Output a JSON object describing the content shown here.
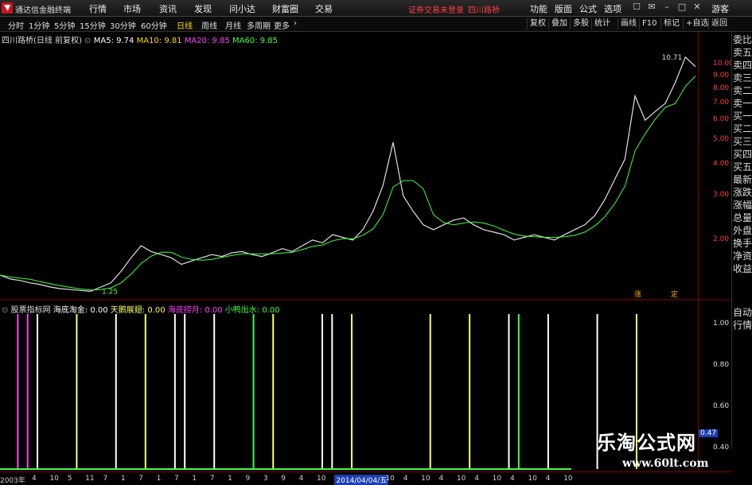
{
  "titlebar": {
    "app_title": "通达信金融终端",
    "menu": [
      "行情",
      "市场",
      "资讯",
      "发现",
      "问小达",
      "财富圈",
      "交易"
    ],
    "warning": "证券交易未登录",
    "stock_name": "四川路桥",
    "right_menu": [
      "功能",
      "版面",
      "公式",
      "选项"
    ],
    "user_label": "游客"
  },
  "toolbar": {
    "periods": [
      "分时",
      "1分钟",
      "5分钟",
      "15分钟",
      "30分钟",
      "60分钟",
      "日线",
      "周线",
      "月线",
      "多周期",
      "更多"
    ],
    "active_period": "日线",
    "right_buttons": [
      "复权",
      "叠加",
      "多股",
      "统计",
      "画线",
      "F10",
      "标记",
      "+自选",
      "返回"
    ]
  },
  "main_chart": {
    "title": "四川路桥(日线 前复权)",
    "ma": [
      {
        "label": "MA5: 9.74",
        "color": "#ffffff"
      },
      {
        "label": "MA10: 9.81",
        "color": "#ffd700"
      },
      {
        "label": "MA20: 9.85",
        "color": "#ff40ff"
      },
      {
        "label": "MA60: 9.85",
        "color": "#40ff40"
      }
    ],
    "high_label": "10.71",
    "low_label": "1.25",
    "event_labels": [
      "涨",
      "定"
    ]
  },
  "right_panel": [
    "委比",
    "卖五",
    "卖四",
    "卖三",
    "卖二",
    "卖一",
    "买一",
    "买二",
    "买三",
    "买四",
    "买五",
    "最新",
    "涨跌",
    "涨幅",
    "总量",
    "外盘",
    "换手",
    "净资",
    "收益",
    "自动",
    "行情"
  ],
  "indicator": {
    "name": "股票指标网",
    "items": [
      {
        "label": "海底淘金: 0.00",
        "color": "#ffffff"
      },
      {
        "label": "天鹅展翅: 0.00",
        "color": "#ffff60"
      },
      {
        "label": "海底捞月: 0.00",
        "color": "#ff40ff"
      },
      {
        "label": "小鸭出水: 0.00",
        "color": "#40ff40"
      }
    ],
    "current_value": "0.47"
  },
  "chart_data": {
    "type": "line",
    "title": "",
    "xlabel": "",
    "ylabel": "",
    "y_scale": "log",
    "ylim": [
      1.2,
      11.5
    ],
    "price_series": {
      "name": "",
      "values": [
        1.45,
        1.4,
        1.38,
        1.35,
        1.33,
        1.3,
        1.28,
        1.27,
        1.26,
        1.25,
        1.3,
        1.35,
        1.5,
        1.7,
        1.9,
        1.8,
        1.75,
        1.7,
        1.6,
        1.65,
        1.7,
        1.75,
        1.72,
        1.78,
        1.8,
        1.75,
        1.72,
        1.78,
        1.85,
        1.8,
        1.9,
        2.0,
        1.95,
        2.1,
        2.05,
        2.0,
        2.2,
        2.6,
        3.3,
        4.9,
        3.0,
        2.6,
        2.3,
        2.2,
        2.3,
        2.4,
        2.45,
        2.3,
        2.2,
        2.15,
        2.1,
        2.0,
        2.05,
        2.1,
        2.05,
        2.0,
        2.1,
        2.2,
        2.3,
        2.5,
        2.9,
        3.5,
        4.2,
        7.5,
        6.0,
        6.5,
        7.0,
        8.5,
        10.71,
        9.8
      ]
    },
    "price_ticks": [
      "10.00",
      "9.00",
      "8.00",
      "7.00",
      "6.00",
      "5.00",
      "4.00",
      "3.00",
      "2.00"
    ],
    "price_tick_values": [
      10,
      9,
      8,
      7,
      6,
      5,
      4,
      3,
      2
    ],
    "indicator_ticks": [
      "1.00",
      "0.80",
      "0.60",
      "0.40"
    ],
    "indicator_tick_values": [
      1.0,
      0.8,
      0.6,
      0.4
    ],
    "indicator_ylim": [
      0.3,
      1.05
    ],
    "signal_count": 70,
    "signals": [
      {
        "index": 1,
        "color": "#ff40ff"
      },
      {
        "index": 2,
        "color": "#ff40ff"
      },
      {
        "index": 3,
        "color": "#ffffff"
      },
      {
        "index": 7,
        "color": "#ffff60"
      },
      {
        "index": 11,
        "color": "#ffffff"
      },
      {
        "index": 14,
        "color": "#ffff60"
      },
      {
        "index": 17,
        "color": "#ffffff"
      },
      {
        "index": 18,
        "color": "#ffffff"
      },
      {
        "index": 21,
        "color": "#ffffff"
      },
      {
        "index": 25,
        "color": "#40ff40"
      },
      {
        "index": 27,
        "color": "#ffff60"
      },
      {
        "index": 32,
        "color": "#ffffff"
      },
      {
        "index": 33,
        "color": "#ffffff"
      },
      {
        "index": 35,
        "color": "#ffff60"
      },
      {
        "index": 43,
        "color": "#ffff60"
      },
      {
        "index": 47,
        "color": "#ffff60"
      },
      {
        "index": 51,
        "color": "#ffffff"
      },
      {
        "index": 52,
        "color": "#40ff40"
      },
      {
        "index": 55,
        "color": "#ffffff"
      },
      {
        "index": 60,
        "color": "#ffffff"
      },
      {
        "index": 64,
        "color": "#ffff60"
      }
    ],
    "date_labels": [
      "2003年",
      "4",
      "10",
      "5",
      "11",
      "7",
      "1",
      "7",
      "1",
      "7",
      "1",
      "7",
      "1",
      "9",
      "3",
      "9",
      "4",
      "10",
      "2014/04/04/五",
      "10",
      "4",
      "10",
      "4",
      "10",
      "4",
      "10",
      "4",
      "10",
      "4",
      "10"
    ],
    "highlight_date": "2014/04/04/五"
  },
  "watermark": {
    "line1": "乐淘公式网",
    "line2": "www.60lt.com"
  }
}
